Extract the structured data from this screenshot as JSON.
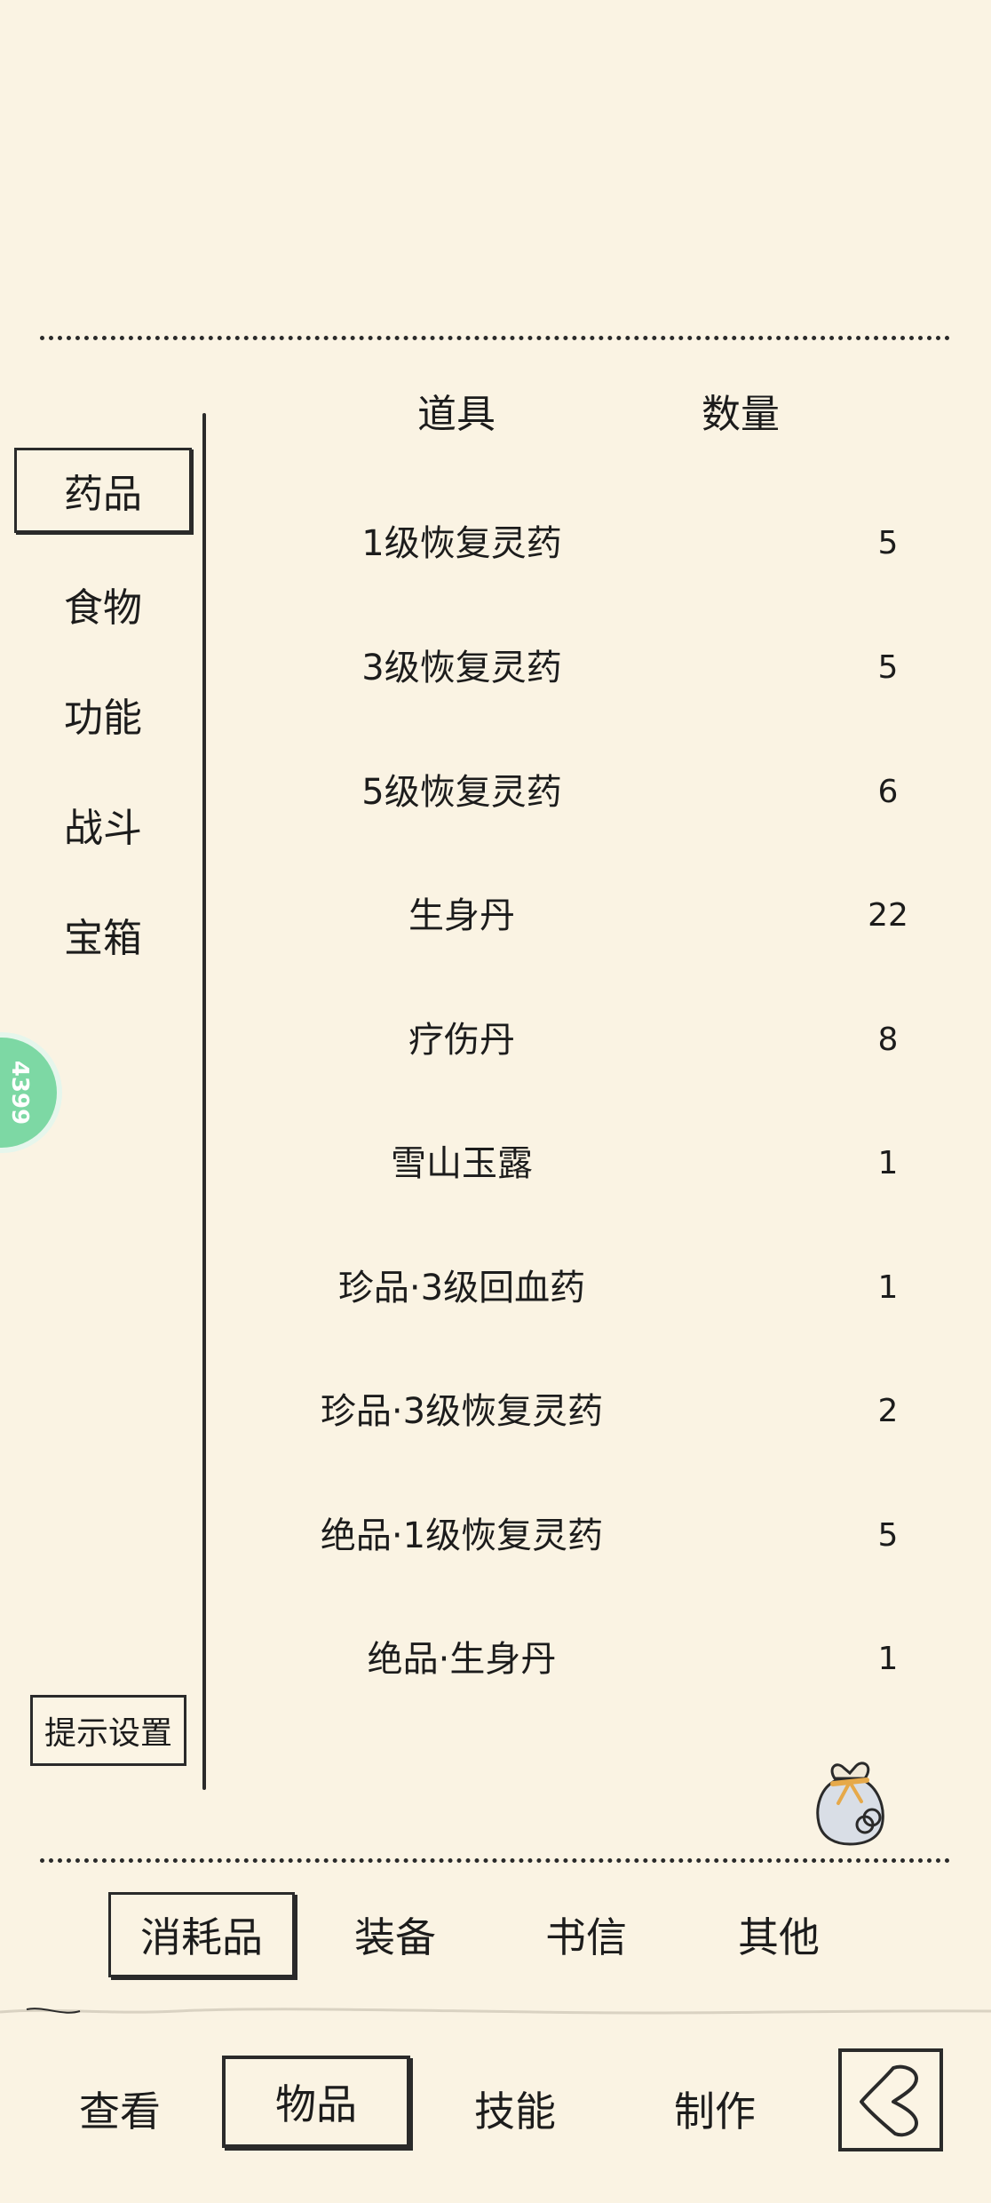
{
  "table": {
    "header_item": "道具",
    "header_qty": "数量",
    "rows": [
      {
        "name": "1级恢复灵药",
        "qty": "5"
      },
      {
        "name": "3级恢复灵药",
        "qty": "5"
      },
      {
        "name": "5级恢复灵药",
        "qty": "6"
      },
      {
        "name": "生身丹",
        "qty": "22"
      },
      {
        "name": "疗伤丹",
        "qty": "8"
      },
      {
        "name": "雪山玉露",
        "qty": "1"
      },
      {
        "name": "珍品·3级回血药",
        "qty": "1"
      },
      {
        "name": "珍品·3级恢复灵药",
        "qty": "2"
      },
      {
        "name": "绝品·1级恢复灵药",
        "qty": "5"
      },
      {
        "name": "绝品·生身丹",
        "qty": "1"
      }
    ]
  },
  "sidebar": {
    "categories": [
      "药品",
      "食物",
      "功能",
      "战斗",
      "宝箱"
    ],
    "selected": "药品",
    "hint_settings": "提示设置"
  },
  "badge": {
    "text": "4399"
  },
  "tabs": {
    "items": [
      "消耗品",
      "装备",
      "书信",
      "其他"
    ],
    "selected": "消耗品"
  },
  "nav": {
    "items": [
      "查看",
      "物品",
      "技能",
      "制作"
    ],
    "selected": "物品"
  },
  "icons": {
    "bag": "item-bag-icon",
    "back": "back-arrow-icon"
  },
  "colors": {
    "background": "#faf3e3",
    "ink": "#2a2a2a",
    "badge_green": "#7dd8a4"
  }
}
